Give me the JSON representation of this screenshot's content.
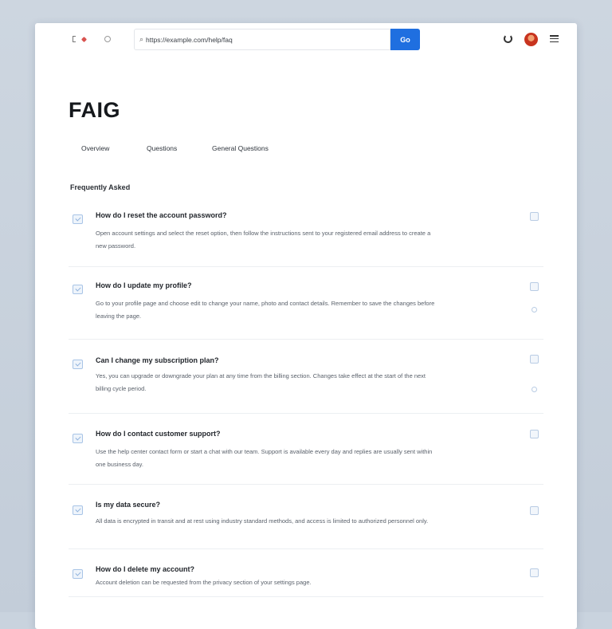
{
  "search": {
    "value": "https://example.com/help/faq",
    "button_label": "Go"
  },
  "page": {
    "title": "FAIG",
    "tabs": [
      {
        "label": "Overview"
      },
      {
        "label": "Questions"
      },
      {
        "label": "General Questions"
      }
    ],
    "section_title": "Frequently Asked"
  },
  "faq": [
    {
      "question": "How do I reset the account password?",
      "answer": "Open account settings and select the reset option, then follow the instructions sent to your registered email address to create a new password."
    },
    {
      "question": "How do I update my profile?",
      "answer": "Go to your profile page and choose edit to change your name, photo and contact details. Remember to save the changes before leaving the page."
    },
    {
      "question": "Can I change my subscription plan?",
      "answer": "Yes, you can upgrade or downgrade your plan at any time from the billing section. Changes take effect at the start of the next billing cycle period."
    },
    {
      "question": "How do I contact customer support?",
      "answer": "Use the help center contact form or start a chat with our team. Support is available every day and replies are usually sent within one business day."
    },
    {
      "question": "Is my data secure?",
      "answer": "All data is encrypted in transit and at rest using industry standard methods, and access is limited to authorized personnel only."
    },
    {
      "question": "How do I delete my account?",
      "answer": "Account deletion can be requested from the privacy section of your settings page."
    }
  ]
}
